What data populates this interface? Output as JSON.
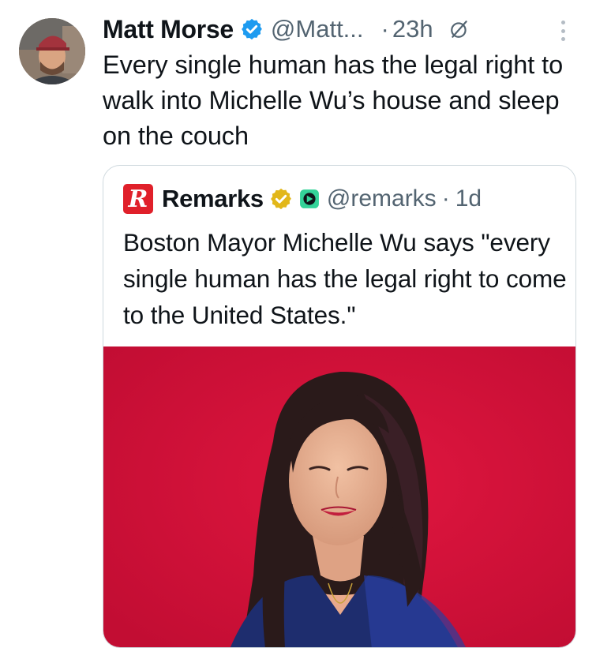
{
  "tweet": {
    "author_name": "Matt Morse",
    "handle": "@Matt...",
    "dot": "·",
    "time": "23h",
    "text": "Every single human has the legal right to walk into Michelle Wu’s house and sleep on the couch",
    "verified_icon": "verified-badge-icon",
    "grok_icon": "grok-icon",
    "more_icon": "more-options-icon"
  },
  "quote": {
    "logo_letter": "R",
    "author_name": "Remarks",
    "handle": "@remarks",
    "dot": "·",
    "time": "1d",
    "text": "Boston Mayor Michelle Wu says \"every single human has the legal right to come to the United States.\"",
    "badge_icon": "gold-verified-badge-icon",
    "affiliation_icon": "affiliate-badge-icon"
  },
  "colors": {
    "text": "#0f1419",
    "secondary": "#536471",
    "verified_blue": "#1d9bf0",
    "gold": "#e2b719",
    "logo_red": "#e0202a",
    "photo_background": "#d1123a"
  }
}
